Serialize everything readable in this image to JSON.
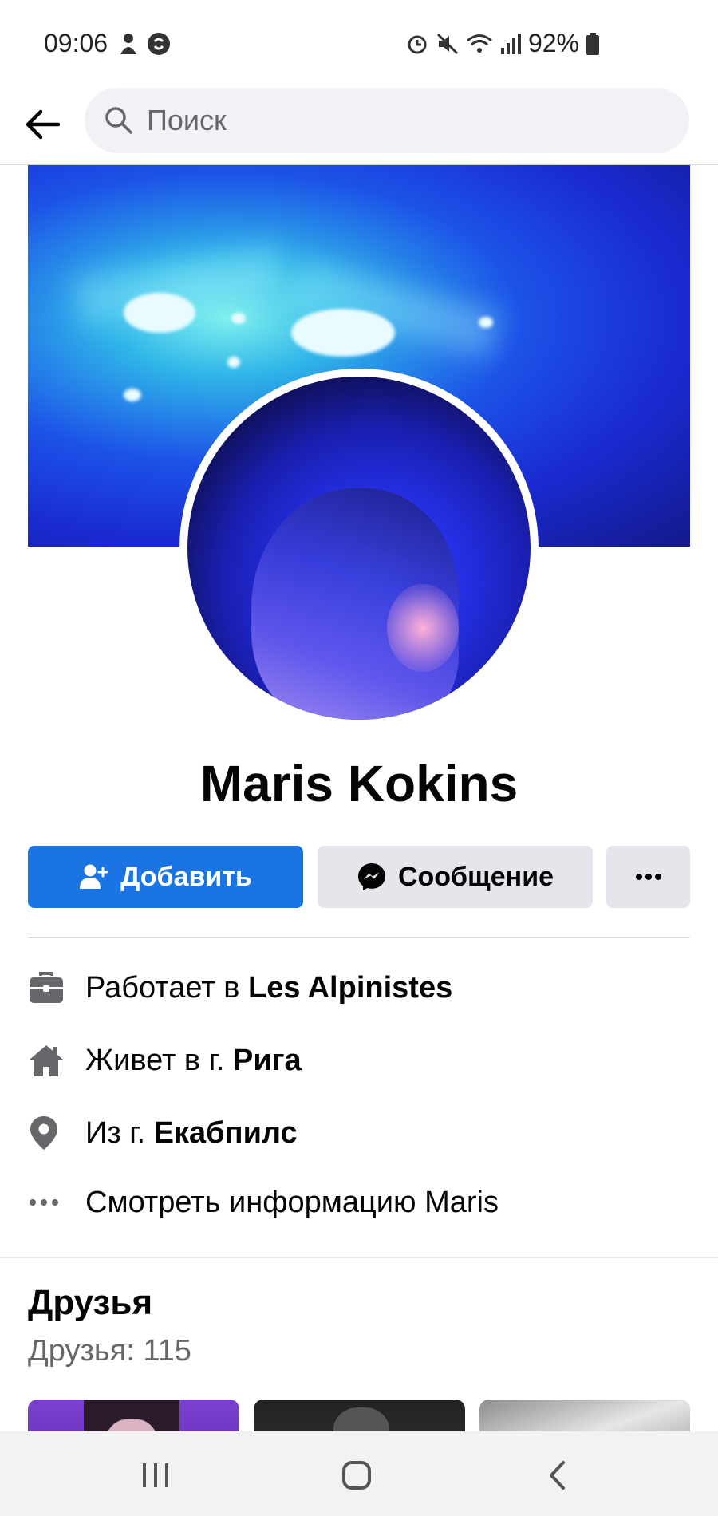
{
  "status_bar": {
    "time": "09:06",
    "battery": "92%"
  },
  "search": {
    "placeholder": "Поиск"
  },
  "profile": {
    "name": "Maris Kokins"
  },
  "actions": {
    "add_label": "Добавить",
    "message_label": "Сообщение",
    "more_label": "···"
  },
  "info": {
    "work_prefix": "Работает в ",
    "work_value": "Les Alpinistes",
    "lives_prefix": "Живет в г. ",
    "lives_value": "Рига",
    "from_prefix": "Из г. ",
    "from_value": "Екабпилс",
    "more_info": "Смотреть информацию Maris"
  },
  "friends": {
    "title": "Друзья",
    "count": "Друзья: 115"
  },
  "colors": {
    "primary": "#1b74e4",
    "secondary_button": "#e4e6eb",
    "muted_text": "#65676b"
  },
  "icons": [
    "back-arrow-icon",
    "search-icon",
    "briefcase-icon",
    "home-icon",
    "location-pin-icon",
    "more-dots-icon",
    "add-friend-icon",
    "messenger-icon"
  ]
}
